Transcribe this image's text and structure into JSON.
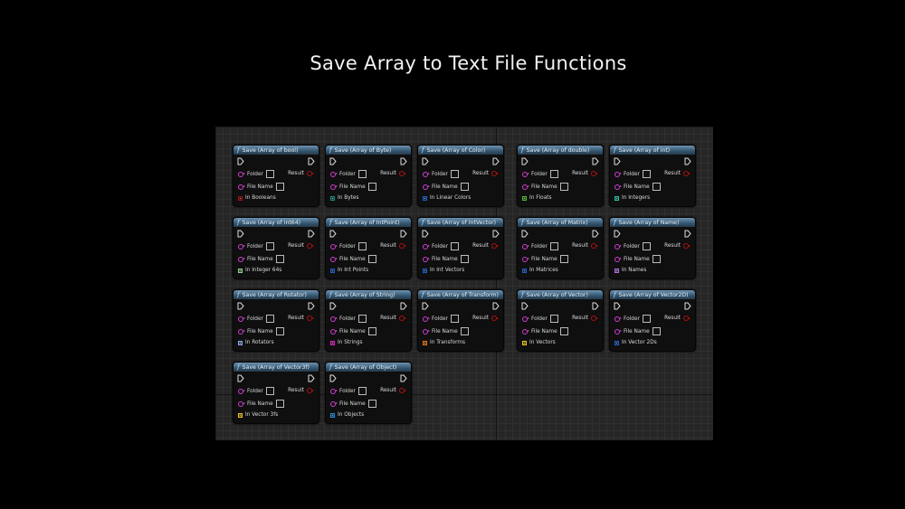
{
  "title": "Save Array to Text File Functions",
  "common": {
    "function_icon": "f",
    "folder_label": "Folder",
    "filename_label": "File Name",
    "result_label": "Result"
  },
  "colors": {
    "string_pin": "#d23ed2",
    "bool_pin": "#b01010"
  },
  "nodes": [
    {
      "title": "Save (Array of bool)",
      "array_label": "In Booleans",
      "array_color": "#a01010"
    },
    {
      "title": "Save (Array of Byte)",
      "array_label": "In Bytes",
      "array_color": "#1a8c80"
    },
    {
      "title": "Save (Array of Color)",
      "array_label": "In Linear Colors",
      "array_color": "#1f5fc8"
    },
    {
      "title": "Save (Array of double)",
      "array_label": "In Floats",
      "array_color": "#4ab82a"
    },
    {
      "title": "Save (Array of int)",
      "array_label": "In Integers",
      "array_color": "#25c4a0"
    },
    {
      "title": "Save (Array of int64)",
      "array_label": "In Integer 64s",
      "array_color": "#8fd08f"
    },
    {
      "title": "Save (Array of IntPoint)",
      "array_label": "In Int Points",
      "array_color": "#1f5fc8"
    },
    {
      "title": "Save (Array of IntVector)",
      "array_label": "In Int Vectors",
      "array_color": "#1f5fc8"
    },
    {
      "title": "Save (Array of Matrix)",
      "array_label": "In Matrices",
      "array_color": "#1f5fc8"
    },
    {
      "title": "Save (Array of Name)",
      "array_label": "In Names",
      "array_color": "#b070e0"
    },
    {
      "title": "Save (Array of Rotator)",
      "array_label": "In Rotators",
      "array_color": "#8fa8f0"
    },
    {
      "title": "Save (Array of String)",
      "array_label": "In Strings",
      "array_color": "#e020c8"
    },
    {
      "title": "Save (Array of Transform)",
      "array_label": "In Transforms",
      "array_color": "#f07010"
    },
    {
      "title": "Save (Array of Vector)",
      "array_label": "In Vectors",
      "array_color": "#f0c020"
    },
    {
      "title": "Save (Array of Vector2D)",
      "array_label": "In Vector 2Ds",
      "array_color": "#1f5fc8"
    },
    {
      "title": "Save (Array of Vector3f)",
      "array_label": "In Vector 3fs",
      "array_color": "#f0c020"
    },
    {
      "title": "Save (Array of Object)",
      "array_label": "In Objects",
      "array_color": "#1f8fe0"
    }
  ]
}
